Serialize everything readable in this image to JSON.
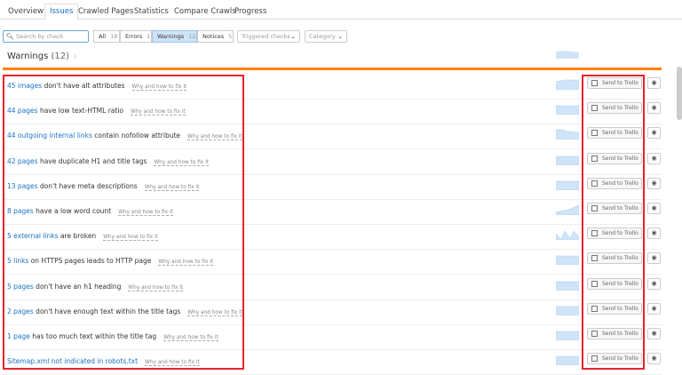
{
  "tabs": [
    "Overview",
    "Issues",
    "Crawled Pages",
    "Statistics",
    "Compare Crawls",
    "Progress"
  ],
  "active_tab": "Issues",
  "search": {
    "placeholder": "Search by check"
  },
  "filters": [
    {
      "label": "All",
      "count": "18"
    },
    {
      "label": "Errors",
      "count": "1"
    },
    {
      "label": "Warnings",
      "count": "12"
    },
    {
      "label": "Notices",
      "count": "5"
    }
  ],
  "dropdowns": [
    "Triggered checks",
    "Category"
  ],
  "section": {
    "title": "Warnings",
    "count": "(12)",
    "info": "i"
  },
  "why_label": "Why and how to fix it",
  "trello_label": "Send to Trello",
  "accent": "#ff8000",
  "highlight": "#e8222a",
  "rows": [
    {
      "link": "45 images",
      "rest": " don't have alt attributes"
    },
    {
      "link": "44 pages",
      "rest": " have low text-HTML ratio"
    },
    {
      "link": "44 outgoing internal links",
      "rest": " contain nofollow attribute"
    },
    {
      "link": "42 pages",
      "rest": " have duplicate H1 and title tags"
    },
    {
      "link": "13 pages",
      "rest": " don't have meta descriptions"
    },
    {
      "link": "8 pages",
      "rest": " have a low word count"
    },
    {
      "link": "5 external links",
      "rest": " are broken"
    },
    {
      "link": "5 links",
      "rest": " on HTTPS pages leads to HTTP page"
    },
    {
      "link": "5 pages",
      "rest": " don't have an h1 heading"
    },
    {
      "link": "2 pages",
      "rest": " don't have enough text within the title tags"
    },
    {
      "link": "1 page",
      "rest": " has too much text within the title tag"
    },
    {
      "link": "Sitemap.xml not indicated in robots.txt",
      "rest": ""
    }
  ]
}
